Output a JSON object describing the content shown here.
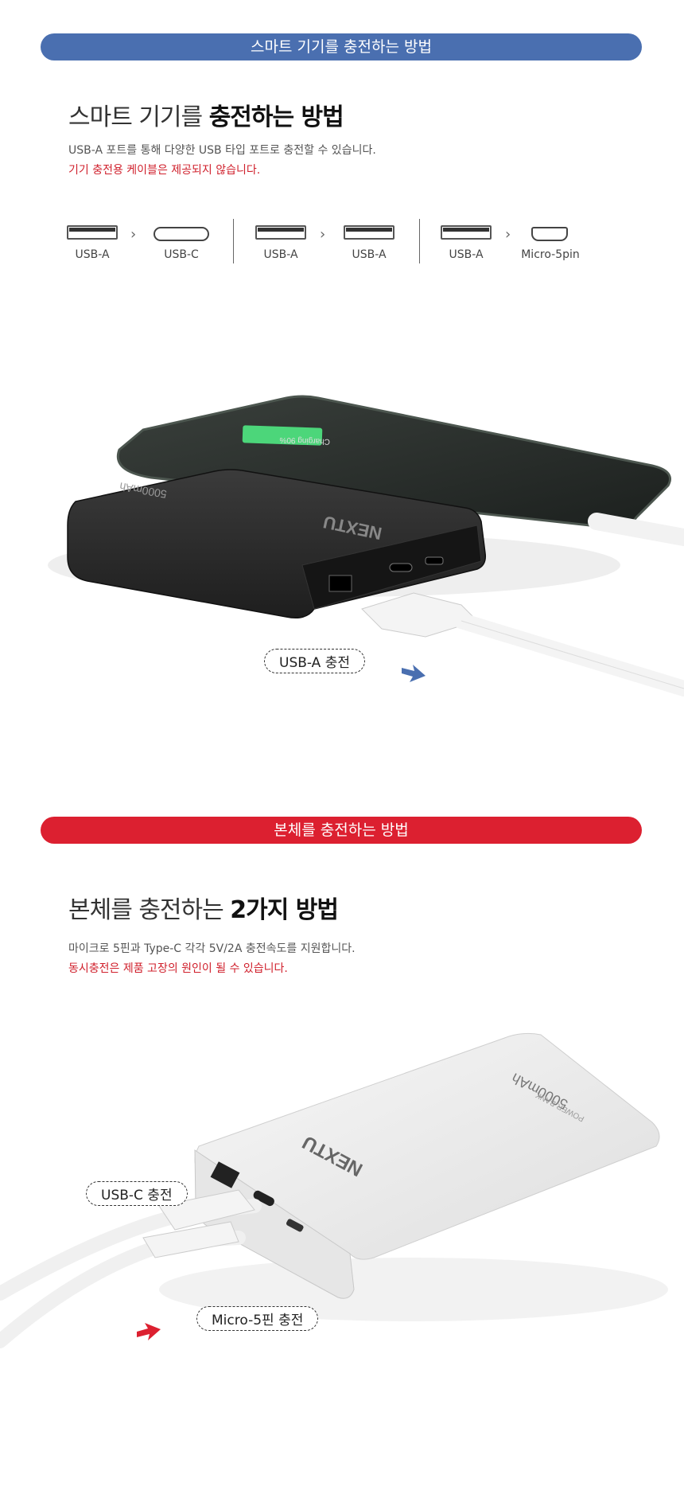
{
  "section1": {
    "banner": "스마트 기기를 충전하는 방법",
    "title_light": "스마트 기기를 ",
    "title_bold": "충전하는 방법",
    "desc": "USB-A 포트를 통해 다양한 USB 타입 포트로 충전할 수 있습니다.",
    "warning": "기기 충전용 케이블은 제공되지 않습니다.",
    "ports": [
      {
        "from": "USB-A",
        "to": "USB-C"
      },
      {
        "from": "USB-A",
        "to": "USB-A"
      },
      {
        "from": "USB-A",
        "to": "Micro-5pin"
      }
    ],
    "callout": "USB-A 충전",
    "product": {
      "brand": "NEXTU",
      "capacity": "5000mAh",
      "phone_status": "Charging 90%"
    }
  },
  "section2": {
    "banner": "본체를 충전하는 방법",
    "title_light": "본체를 충전하는 ",
    "title_bold": "2가지 방법",
    "desc": "마이크로 5핀과 Type-C 각각 5V/2A 충전속도를 지원합니다.",
    "warning": "동시충전은 제품 고장의 원인이 될 수 있습니다.",
    "callout_c": "USB-C 충전",
    "callout_micro": "Micro-5핀 충전",
    "product": {
      "brand": "NEXTU",
      "capacity": "5000mAh",
      "subtitle": "POWER BANK"
    }
  },
  "colors": {
    "blue": "#4a6fb0",
    "red": "#dc2030",
    "green": "#4cd67a"
  }
}
